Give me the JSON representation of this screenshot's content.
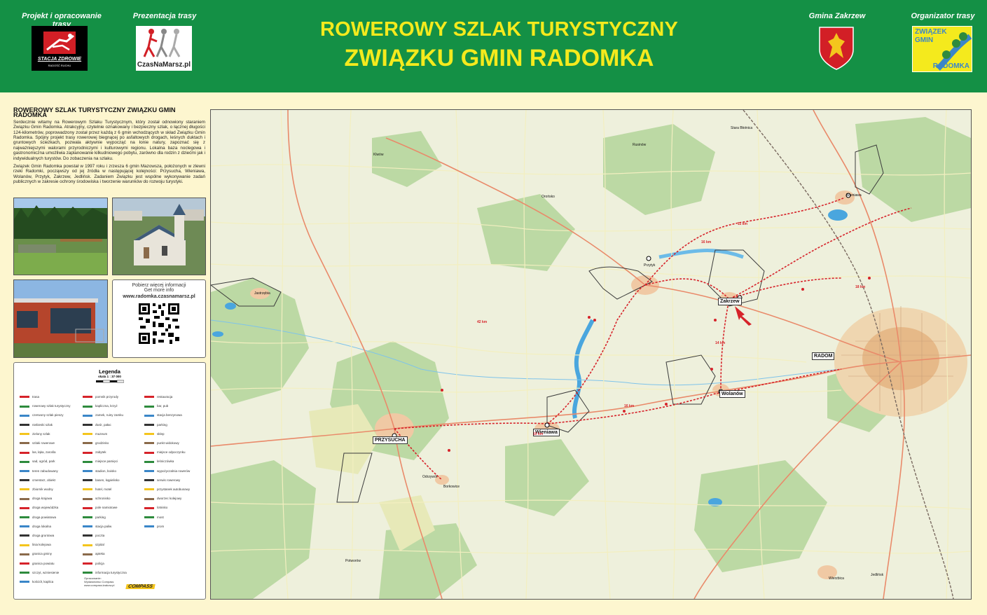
{
  "header": {
    "label_project": "Projekt i opracowanie trasy",
    "label_presentation": "Prezentacja trasy",
    "label_gmina": "Gmina Zakrzew",
    "label_organizer": "Organizator trasy",
    "title_line1": "ROWEROWY SZLAK TURYSTYCZNY",
    "title_line2": "ZWIĄZKU GMIN RADOMKA",
    "logo_stacja_line1": "STACJA ZDROWIE",
    "logo_stacja_line2": "RADOŚĆ RUCHU",
    "logo_czas": "CzasNaMarsz.pl",
    "logo_zwiazek_line1": "ZWIĄZEK",
    "logo_zwiazek_line2": "GMIN",
    "logo_zwiazek_line3": "RADOMKA"
  },
  "intro": {
    "heading": "ROWEROWY SZLAK TURYSTYCZNY ZWIĄZKU GMIN RADOMKA",
    "paragraph1": "Serdecznie witamy na Rowerowym Szlaku Turystycznym, który został odnowiony staraniem Związku Gmin Radomka. Atrakcyjny, czytelnie oznakowany i bezpieczny szlak, o łącznej długości 124-kilometrów, poprowadzony został przez każdą z 6 gmin wchodzących w skład Związku Gmin Radomka. Spójny projekt trasy rowerowej biegnącej po asfaltowych drogach, leśnych duktach i gruntowych ścieżkach, pozwala aktywnie wypocząć na łonie natury, zapoznać się z najważniejszymi walorami przyrodniczymi i kulturowymi regionu. Lokalna baza noclegowa i gastronomiczna umożliwia zaplanowanie kilkudniowego pobytu, zarówno dla rodzin z dziećmi jak i indywidualnych turystów. Do zobaczenia na szlaku.",
    "paragraph2": "Związek Gmin Radomka powstał w 1997 roku i zrzesza 6 gmin Mazowsza, położonych w zlewni rzeki Radomki, począwszy od jej źródła w następującej kolejności: Przysucha, Wieniawa, Wolanów, Przytyk, Zakrzew, Jedlińsk. Zadaniem Związku jest wspólne wykonywanie zadań publicznych w zakresie ochrony środowiska i tworzenie warunków do rozwoju turystyki."
  },
  "info_box": {
    "line1": "Pobierz więcej informacji",
    "line2": "Get more info",
    "url": "www.radomka.czasnamarsz.pl"
  },
  "legend": {
    "title": "Legenda",
    "scale": "skala 1 : 37 000",
    "col1": [
      "trasa",
      "rowerowy szlak turystyczny",
      "czerwony szlak pieszy",
      "niebieski szlak",
      "zielony szlak",
      "szlaki rowerowe",
      "las, łąka, zarośla",
      "sad, ogród, park",
      "teren zabudowany",
      "cmentarz, obiekt",
      "zbiornik wodny",
      "droga krajowa",
      "droga wojewódzka",
      "droga powiatowa",
      "droga lokalna",
      "droga gruntowa",
      "linia kolejowa",
      "granica gminy",
      "granica powiatu",
      "szczyt, wzniesienie",
      "kościół, kaplica"
    ],
    "col2": [
      "pomnik przyrody",
      "kapliczna, krzyż",
      "zamek, ruiny zamku",
      "dwór, pałac",
      "muzeum",
      "grodzisko",
      "zabytek",
      "miejsce pamięci",
      "stadion, boisko",
      "basen, kąpielisko",
      "hotel, motel",
      "schronisko",
      "pole namiotowe",
      "parking",
      "stacja paliw",
      "poczta",
      "szpital",
      "apteka",
      "policja",
      "informacja turystyczna"
    ],
    "col3": [
      "restauracja",
      "bar, pub",
      "stacja benzynowa",
      "parking",
      "sklep",
      "punkt widokowy",
      "miejsce odpoczynku",
      "leśniczówka",
      "wypożyczalnia rowerów",
      "serwis rowerowy",
      "przystanek autobusowy",
      "dworzec kolejowy",
      "lotnisko",
      "most",
      "prom"
    ],
    "footer_line1": "Opracowanie:",
    "footer_line2": "Wydawnictwo Compass",
    "footer_line3": "www.compass.krakow.pl",
    "compass_logo": "COMPASS"
  },
  "map": {
    "towns": [
      "RADOM",
      "PRZYSUCHA",
      "Zakrzew",
      "Wolanów",
      "Wieniawa",
      "Przytyk",
      "Jedlińsk",
      "Wieniawa",
      "Odrzywół",
      "Potworów",
      "Wierzbica",
      "Orońsko",
      "Borkowice",
      "Rusinów",
      "Klwów",
      "Stara Błotnica",
      "Jastrzębia"
    ],
    "distances": [
      "16 km",
      "11 km",
      "42 km",
      "16 km",
      "10 km",
      "14 km",
      "18 km"
    ]
  },
  "colors": {
    "header_green": "#149045",
    "title_yellow": "#f4ea1d",
    "background": "#fdf6cf",
    "route_red": "#d6232a"
  }
}
